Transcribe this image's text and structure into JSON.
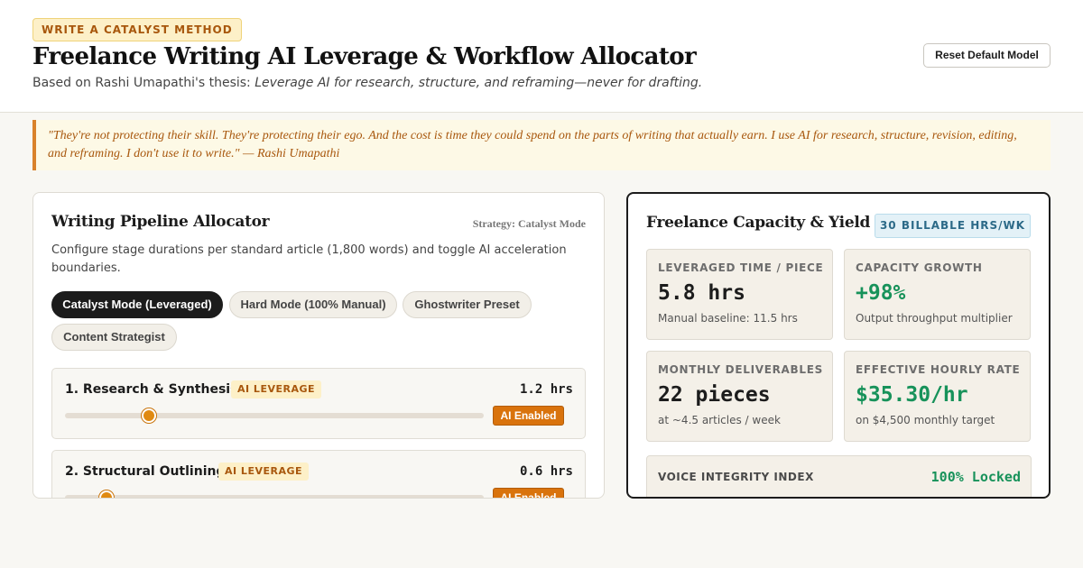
{
  "header": {
    "badge": "WRITE A CATALYST METHOD",
    "title": "Freelance Writing AI Leverage & Workflow Allocator",
    "subtitle_prefix": "Based on Rashi Umapathi's thesis: ",
    "subtitle_thesis": "Leverage AI for research, structure, and reframing—never for drafting.",
    "reset_label": "Reset Default Model"
  },
  "quote": "\"They're not protecting their skill. They're protecting their ego. And the cost is time they could spend on the parts of writing that actually earn. I use AI for research, structure, revision, editing, and reframing. I don't use it to write.\" — Rashi Umapathi",
  "pipeline": {
    "title": "Writing Pipeline Allocator",
    "strategy": "Strategy: Catalyst Mode",
    "description": "Configure stage durations per standard article (1,800 words) and toggle AI acceleration boundaries.",
    "modes": [
      {
        "label": "Catalyst Mode (Leveraged)",
        "active": true
      },
      {
        "label": "Hard Mode (100% Manual)",
        "active": false
      },
      {
        "label": "Ghostwriter Preset",
        "active": false
      },
      {
        "label": "Content Strategist",
        "active": false
      }
    ],
    "stages": [
      {
        "name": "1. Research & Synthesis",
        "tag": "AI LEVERAGE",
        "hours": "1.2 hrs",
        "level": 0.2,
        "button": "AI Enabled"
      },
      {
        "name": "2. Structural Outlining",
        "tag": "AI LEVERAGE",
        "hours": "0.6 hrs",
        "level": 0.1,
        "button": "AI Enabled"
      }
    ]
  },
  "capacity": {
    "title": "Freelance Capacity & Yield",
    "billable": "30 BILLABLE HRS/WK",
    "stats": [
      {
        "label": "LEVERAGED TIME / PIECE",
        "value": "5.8 hrs",
        "sub": "Manual baseline: 11.5 hrs",
        "accent": false
      },
      {
        "label": "CAPACITY GROWTH",
        "value": "+98%",
        "sub": "Output throughput multiplier",
        "accent": true
      },
      {
        "label": "MONTHLY DELIVERABLES",
        "value": "22 pieces",
        "sub": "at ~4.5 articles / week",
        "accent": false
      },
      {
        "label": "EFFECTIVE HOURLY RATE",
        "value": "$35.30/hr",
        "sub": "on $4,500 monthly target",
        "accent": true
      }
    ],
    "voice": {
      "label": "VOICE INTEGRITY INDEX",
      "value": "100% Locked"
    }
  },
  "colors": {
    "accent_orange": "#d9730d",
    "accent_green": "#17925a",
    "badge_bg": "#fdf0c8",
    "dark": "#1c1c1c"
  }
}
